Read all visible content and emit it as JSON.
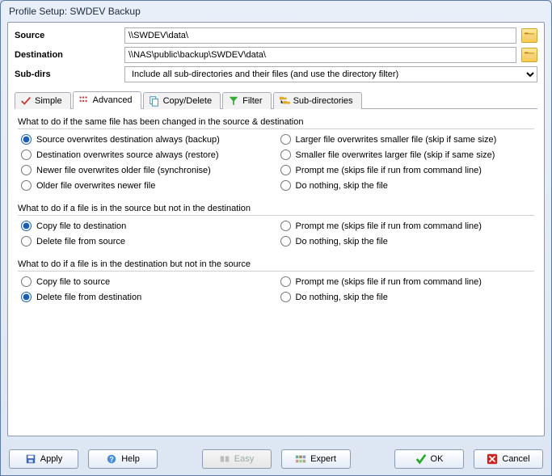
{
  "window": {
    "title": "Profile Setup: SWDEV Backup"
  },
  "form": {
    "source_label": "Source",
    "source_value": "\\\\SWDEV\\data\\",
    "destination_label": "Destination",
    "destination_value": "\\\\NAS\\public\\backup\\SWDEV\\data\\",
    "subdirs_label": "Sub-dirs",
    "subdirs_value": "Include all sub-directories and their files (and use the directory filter)"
  },
  "tabs": {
    "simple": "Simple",
    "advanced": "Advanced",
    "copydelete": "Copy/Delete",
    "filter": "Filter",
    "subdirectories": "Sub-directories"
  },
  "sections": {
    "s1_head": "What to do if the same file has been changed in the source & destination",
    "s1": {
      "a": "Source overwrites destination always (backup)",
      "b": "Destination overwrites source always (restore)",
      "c": "Newer file overwrites older file (synchronise)",
      "d": "Older file overwrites newer file",
      "e": "Larger file overwrites smaller file (skip if same size)",
      "f": "Smaller file overwrites larger file (skip if same size)",
      "g": "Prompt me (skips file if run from command line)",
      "h": "Do nothing, skip the file"
    },
    "s2_head": "What to do if a file is in the source but not in the destination",
    "s2": {
      "a": "Copy file to destination",
      "b": "Delete file from source",
      "c": "Prompt me  (skips file if run from command line)",
      "d": "Do nothing, skip the file"
    },
    "s3_head": "What to do if a file is in the destination but not in the source",
    "s3": {
      "a": "Copy file to source",
      "b": "Delete file from destination",
      "c": "Prompt me  (skips file if run from command line)",
      "d": "Do nothing, skip the file"
    }
  },
  "buttons": {
    "apply": "Apply",
    "help": "Help",
    "easy": "Easy",
    "expert": "Expert",
    "ok": "OK",
    "cancel": "Cancel"
  },
  "icons": {
    "folder": "folder-icon",
    "check_green": "✔",
    "x_red": "✖"
  }
}
